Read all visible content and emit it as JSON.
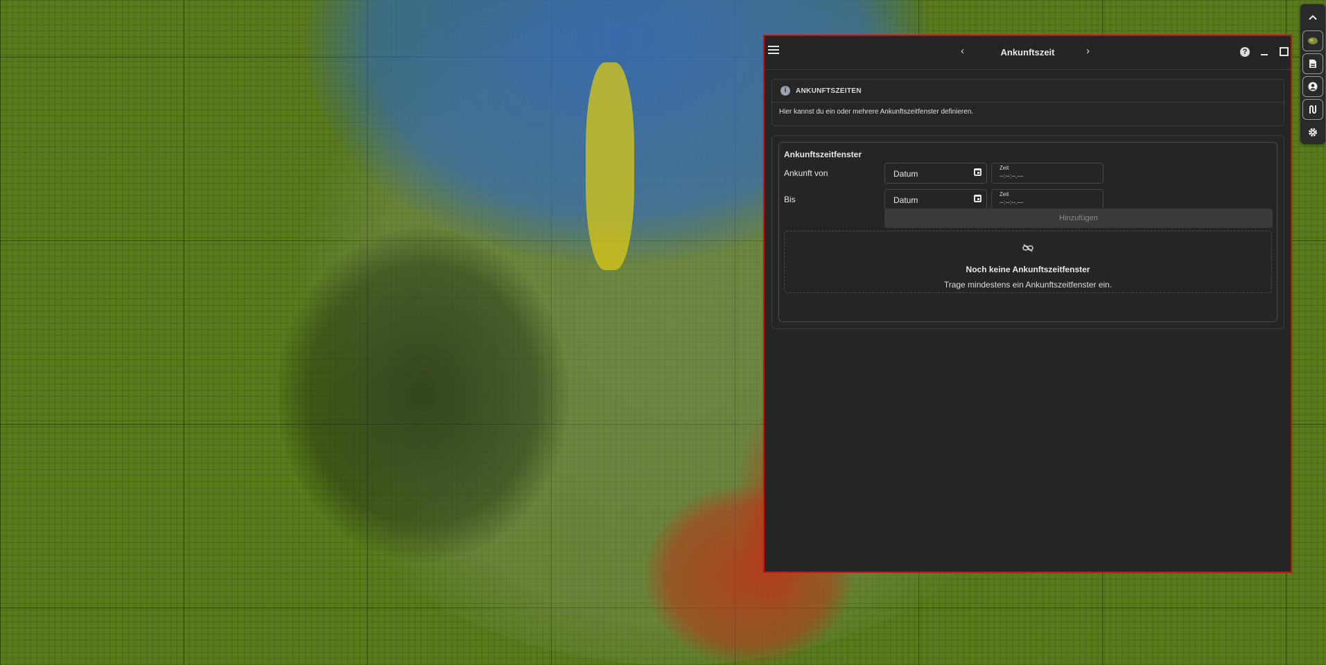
{
  "window": {
    "title": "Ankunftszeit",
    "prev_icon": "‹",
    "next_icon": "›",
    "help_icon": "?"
  },
  "info": {
    "icon": "i",
    "title": "ANKUNFTSZEITEN",
    "text": "Hier kannst du ein oder mehrere Ankunftszeitfenster definieren."
  },
  "form": {
    "section_title": "Ankunftszeitfenster",
    "rows": [
      {
        "label": "Ankunft von",
        "date_value": "Datum",
        "time_label": "Zeit",
        "time_value": "--:--:--.---"
      },
      {
        "label": "Bis",
        "date_value": "Datum",
        "time_label": "Zeit",
        "time_value": "--:--:--.---"
      }
    ],
    "add_label": "Hinzufügen"
  },
  "empty_state": {
    "title": "Noch keine Ankunftszeitfenster",
    "text": "Trage mindestens ein Ankunftszeitfenster ein."
  },
  "toolbar": {
    "icons": [
      "chevron-up-icon",
      "map-icon",
      "document-icon",
      "user-icon",
      "route-icon",
      "gear-icon"
    ]
  },
  "colors": {
    "window_border": "#d01010",
    "window_bg": "#252525",
    "map_green": "#5a7a1c"
  }
}
